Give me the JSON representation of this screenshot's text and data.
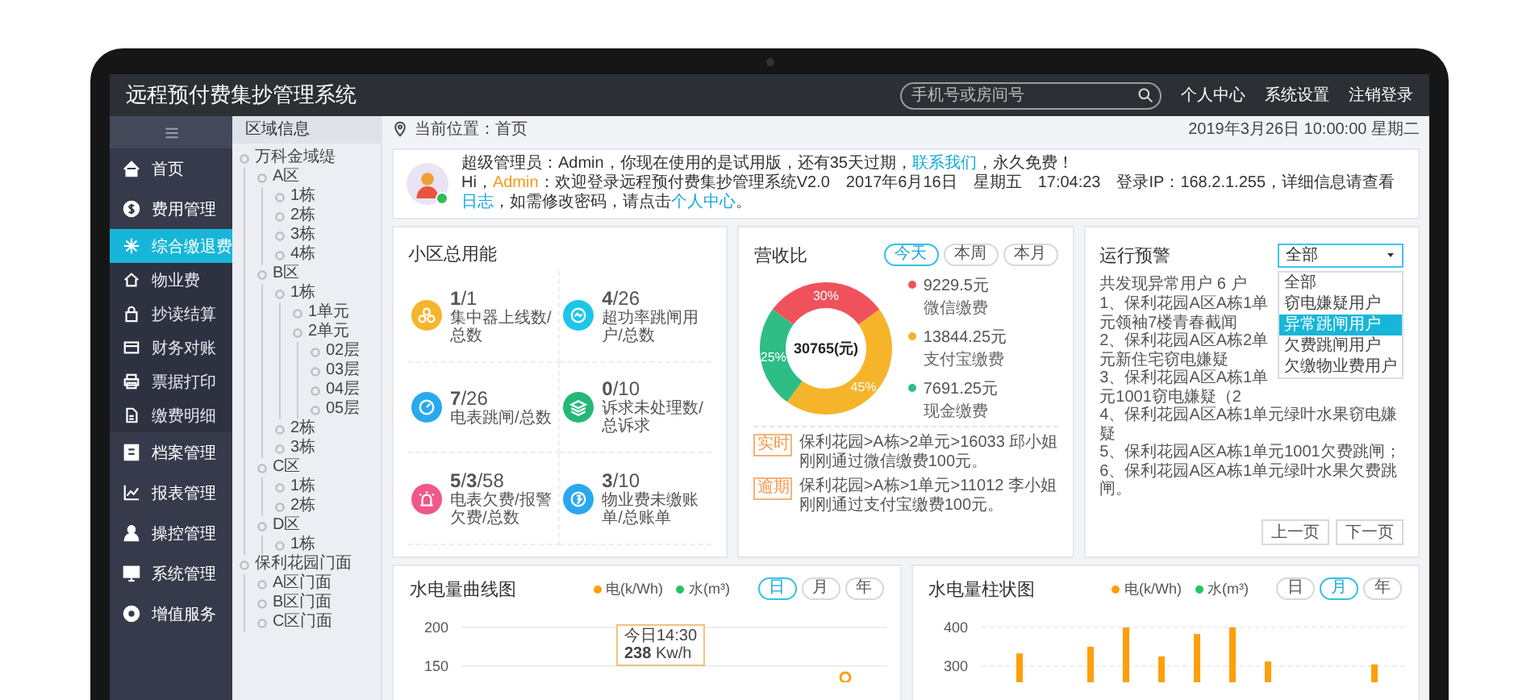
{
  "window": {
    "title": "远程预付费集抄管理系统"
  },
  "header": {
    "search": {
      "placeholder": "手机号或房间号"
    },
    "links": [
      "个人中心",
      "系统设置",
      "注销登录"
    ]
  },
  "sidebar": {
    "items": [
      {
        "label": "首页",
        "selected": false
      },
      {
        "label": "费用管理",
        "selected": false,
        "expanded": true,
        "children": [
          {
            "label": "综合缴退费",
            "selected": true
          },
          {
            "label": "物业费",
            "selected": false
          },
          {
            "label": "抄读结算",
            "selected": false
          },
          {
            "label": "财务对账",
            "selected": false
          },
          {
            "label": "票据打印",
            "selected": false
          },
          {
            "label": "缴费明细",
            "selected": false
          }
        ]
      },
      {
        "label": "档案管理",
        "selected": false
      },
      {
        "label": "报表管理",
        "selected": false
      },
      {
        "label": "操控管理",
        "selected": false
      },
      {
        "label": "系统管理",
        "selected": false
      },
      {
        "label": "增值服务",
        "selected": false
      }
    ]
  },
  "region_tree": {
    "title": "区域信息",
    "nodes": [
      {
        "label": "万科金域缇",
        "children": [
          {
            "label": "A区",
            "children": [
              {
                "label": "1栋"
              },
              {
                "label": "2栋"
              },
              {
                "label": "3栋"
              },
              {
                "label": "4栋"
              }
            ]
          },
          {
            "label": "B区",
            "children": [
              {
                "label": "1栋",
                "children": [
                  {
                    "label": "1单元"
                  },
                  {
                    "label": "2单元",
                    "children": [
                      {
                        "label": "02层"
                      },
                      {
                        "label": "03层"
                      },
                      {
                        "label": "04层"
                      },
                      {
                        "label": "05层"
                      }
                    ]
                  }
                ]
              },
              {
                "label": "2栋"
              },
              {
                "label": "3栋"
              }
            ]
          },
          {
            "label": "C区",
            "children": [
              {
                "label": "1栋"
              },
              {
                "label": "2栋"
              }
            ]
          },
          {
            "label": "D区",
            "children": [
              {
                "label": "1栋"
              }
            ]
          }
        ]
      },
      {
        "label": "保利花园门面",
        "children": [
          {
            "label": "A区门面"
          },
          {
            "label": "B区门面"
          },
          {
            "label": "C区门面"
          }
        ]
      }
    ]
  },
  "breadcrumb": {
    "location": "当前位置：首页",
    "datetime": "2019年3月26日 10:00:00  星期二"
  },
  "welcome": {
    "online": true,
    "lines": [
      [
        {
          "kind": "text",
          "text": "超级管理员：Admin，你现在使用的是试用版，还有35天过期，"
        },
        {
          "kind": "link",
          "text": "联系我们"
        },
        {
          "kind": "text",
          "text": "，永久免费！"
        }
      ],
      [
        {
          "kind": "text",
          "text": "Hi，"
        },
        {
          "kind": "highlight",
          "text": "Admin"
        },
        {
          "kind": "text",
          "text": "：欢迎登录远程预付费集抄管理系统V2.0　2017年6月16日　星期五　17:04:23　登录IP：168.2.1.255，详细信息请查看"
        },
        {
          "kind": "link",
          "text": "日志"
        },
        {
          "kind": "text",
          "text": "，如需修改密码，请点击"
        },
        {
          "kind": "link",
          "text": "个人中心"
        },
        {
          "kind": "text",
          "text": "。"
        }
      ]
    ]
  },
  "energy_card": {
    "title": "小区总用能",
    "stats": [
      {
        "value": "**1**/1",
        "label": "集中器上线数/总数",
        "color": "#f7b52c"
      },
      {
        "value": "**4**/26",
        "label": "超功率跳闸用户/总数",
        "color": "#1cc6e8"
      },
      {
        "value": "**7**/26",
        "label": "电表跳闸/总数",
        "color": "#29a9f0"
      },
      {
        "value": "**0**/10",
        "label": "诉求未处理数/总诉求",
        "color": "#25b777"
      },
      {
        "value": "**5**/**3**/58",
        "label": "电表欠费/报警欠费/总数",
        "color": "#f0578a"
      },
      {
        "value": "**3**/10",
        "label": "物业费未缴账单/总账单",
        "color": "#2aa8ef"
      }
    ]
  },
  "revenue_card": {
    "title": "营收比",
    "tabs": [
      {
        "label": "今天",
        "selected": true
      },
      {
        "label": "本周",
        "selected": false
      },
      {
        "label": "本月",
        "selected": false
      }
    ],
    "chart_data": {
      "type": "donut",
      "categories": [
        "微信缴费",
        "支付宝缴费",
        "现金缴费"
      ],
      "values": [
        30,
        45,
        25
      ],
      "data_labels": true,
      "value_labels": [
        "30%",
        "45%",
        "25%"
      ]
    },
    "center_label": "30765(元)",
    "legend": [
      {
        "amount": "9229.5元",
        "color": "#f0525c"
      },
      {
        "amount": "13844.25元",
        "color": "#f5b42a"
      },
      {
        "amount": "7691.25元",
        "color": "#2dbd85"
      }
    ],
    "notices": [
      {
        "tag": "实时",
        "text": "保利花园>A栋>2单元>16033 邱小姐刚刚通过微信缴费100元。"
      },
      {
        "tag": "逾期",
        "text": "保利花园>A栋>1单元>11012 李小姐刚刚通过支付宝缴费100元。"
      }
    ]
  },
  "alarm_card": {
    "title": "运行预警",
    "filter": {
      "value": "全部",
      "expanded": true,
      "options": [
        {
          "label": "全部",
          "highlighted": false
        },
        {
          "label": "窃电嫌疑用户",
          "highlighted": false
        },
        {
          "label": "异常跳闸用户",
          "highlighted": true
        },
        {
          "label": "欠费跳闸用户",
          "highlighted": false
        },
        {
          "label": "欠缴物业费用户",
          "highlighted": false
        }
      ]
    },
    "summary": "共发现异常用户 6 户",
    "items": [
      "1、保利花园A区A栋1单元领袖7楼青春截闻",
      "2、保利花园A区A栋2单元新住宅窃电嫌疑",
      "3、保利花园A区A栋1单元1001窃电嫌疑（2",
      "4、保利花园A区A栋1单元绿叶水果窃电嫌疑",
      "5、保利花园A区A栋1单元1001欠费跳闸；",
      "6、保利花园A区A栋1单元绿叶水果欠费跳闸。"
    ],
    "pager": [
      "上一页",
      "下一页"
    ]
  },
  "line_chart_card": {
    "title": "水电量曲线图",
    "periods": [
      {
        "label": "日",
        "selected": true
      },
      {
        "label": "月",
        "selected": false
      },
      {
        "label": "年",
        "selected": false
      }
    ],
    "chart_data": {
      "type": "line",
      "series": [
        {
          "name": "电(k/Wh)",
          "color": "#ff9f0a"
        },
        {
          "name": "水(m³)",
          "color": "#22c55e"
        }
      ],
      "ylim": [
        150,
        200
      ],
      "yticks": [
        150,
        200
      ]
    },
    "tooltip": {
      "time": "今日14:30",
      "value": "**238** Kw/h"
    }
  },
  "bar_chart_card": {
    "title": "水电量柱状图",
    "periods": [
      {
        "label": "日",
        "selected": false
      },
      {
        "label": "月",
        "selected": true
      },
      {
        "label": "年",
        "selected": false
      }
    ],
    "chart_data": {
      "type": "bar",
      "series": [
        {
          "name": "电(k/Wh)",
          "color": "#ff9f0a",
          "values": [
            333,
            null,
            350,
            400,
            325,
            383,
            400,
            312,
            null,
            null,
            304
          ]
        },
        {
          "name": "水(m³)",
          "color": "#22c55e"
        }
      ],
      "ylim": [
        300,
        400
      ],
      "yticks": [
        300,
        400
      ]
    }
  }
}
